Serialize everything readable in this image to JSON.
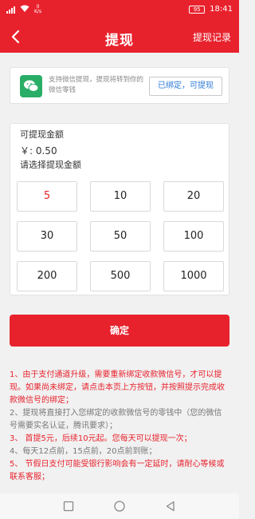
{
  "status": {
    "network_speed": "0\nK/s",
    "battery": "95",
    "time": "18:41"
  },
  "nav": {
    "title": "提现",
    "right_label": "提现记录"
  },
  "wechat": {
    "desc": "支持微信提现，提现将转到你的微信零钱",
    "bound_label": "已绑定，可提现"
  },
  "amount": {
    "label": "可提现金额",
    "value": "￥: 0.50",
    "hint": "请选择提现金额",
    "options": [
      "5",
      "10",
      "20",
      "30",
      "50",
      "100",
      "200",
      "500",
      "1000"
    ],
    "selected": "5"
  },
  "confirm_label": "确定",
  "notes": [
    {
      "text": "1、由于支付通道升级，需要重新绑定收款微信号，才可以提现。如果尚未绑定，请点击本页上方按钮，并按照提示完成收款微信号的绑定；",
      "style": "mixed"
    },
    {
      "text": "2、提现将直接打入您绑定的收款微信号的零钱中（您的微信号需要实名认证，腾讯要求）；",
      "style": "gray"
    },
    {
      "text": "3、 首提5元，后续10元起。您每天可以提现一次；",
      "style": "mixed"
    },
    {
      "text": "4、每天12点前，15点前，20点前到账；",
      "style": "gray"
    },
    {
      "text": "5、 节假日支付可能受银行影响会有一定延时，请耐心等候或联系客服；",
      "style": "mixed"
    }
  ],
  "colors": {
    "accent": "#e8222d",
    "link": "#2d7bd6",
    "wechat": "#2aae67"
  }
}
